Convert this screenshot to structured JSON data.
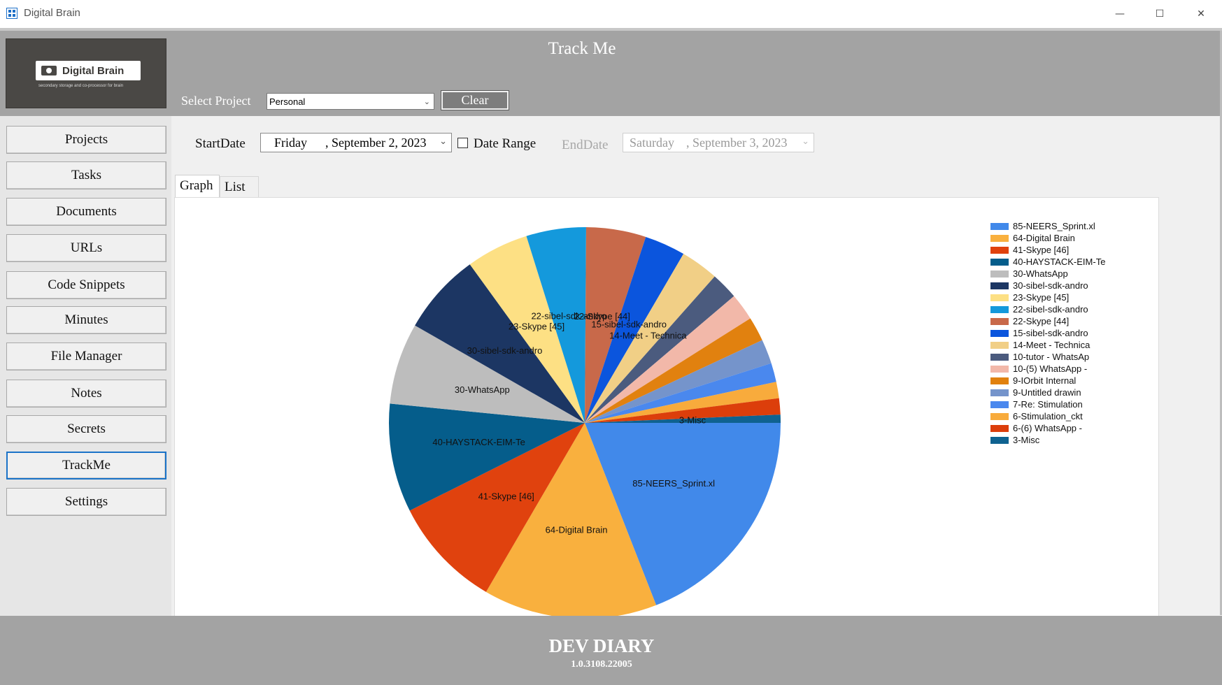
{
  "window": {
    "title": "Digital Brain",
    "minimize": "—",
    "maximize": "☐",
    "close": "✕"
  },
  "logo": {
    "name": "Digital Brain",
    "tagline": "secondary storage and co-processor for brain"
  },
  "header": {
    "title": "Track Me",
    "select_label": "Select Project",
    "project_value": "Personal",
    "clear_label": "Clear"
  },
  "sidebar": {
    "items": [
      {
        "label": "Projects"
      },
      {
        "label": "Tasks"
      },
      {
        "label": "Documents"
      },
      {
        "label": "URLs"
      },
      {
        "label": "Code Snippets"
      },
      {
        "label": "Minutes"
      },
      {
        "label": "File Manager"
      },
      {
        "label": "Notes"
      },
      {
        "label": "Secrets"
      },
      {
        "label": "TrackMe"
      },
      {
        "label": "Settings"
      }
    ],
    "active": "TrackMe"
  },
  "filters": {
    "start_label": "StartDate",
    "start": {
      "day": "Friday",
      "rest": ", September   2, 2023"
    },
    "range_label": "Date Range",
    "range_checked": false,
    "end_label": "EndDate",
    "end": {
      "day": "Saturday",
      "rest": ", September   3, 2023"
    }
  },
  "tabs": {
    "graph": "Graph",
    "list": "List",
    "active": "Graph"
  },
  "chart_data": {
    "type": "pie",
    "start_angle_deg": 0,
    "direction": "clockwise",
    "slices": [
      {
        "label": "85-NEERS_Sprint.xl",
        "value": 85,
        "color": "#4189ea",
        "show_label": true
      },
      {
        "label": "64-Digital Brain",
        "value": 64,
        "color": "#f9b03e",
        "show_label": true
      },
      {
        "label": "41-Skype [46]",
        "value": 41,
        "color": "#e0420e",
        "show_label": true
      },
      {
        "label": "40-HAYSTACK-EIM-Te",
        "value": 40,
        "color": "#055d8b",
        "show_label": true
      },
      {
        "label": "30-WhatsApp",
        "value": 30,
        "color": "#bdbdbd",
        "show_label": true
      },
      {
        "label": "30-sibel-sdk-andro",
        "value": 30,
        "color": "#1c3663",
        "show_label": true
      },
      {
        "label": "23-Skype [45]",
        "value": 23,
        "color": "#fde084",
        "show_label": true
      },
      {
        "label": "22-sibel-sdk-andro",
        "value": 22,
        "color": "#1499dc",
        "show_label": true
      },
      {
        "label": "22-Skype [44]",
        "value": 22,
        "color": "#c8694a",
        "show_label": true
      },
      {
        "label": "15-sibel-sdk-andro",
        "value": 15,
        "color": "#0b55dd",
        "show_label": true
      },
      {
        "label": "14-Meet - Technica",
        "value": 14,
        "color": "#f1cf86",
        "show_label": true
      },
      {
        "label": "10-tutor - WhatsAp",
        "value": 10,
        "color": "#4b5b7e",
        "show_label": false
      },
      {
        "label": "10-(5) WhatsApp -",
        "value": 10,
        "color": "#f2b8a9",
        "show_label": false
      },
      {
        "label": "9-IOrbit Internal",
        "value": 9,
        "color": "#e1810f",
        "show_label": false
      },
      {
        "label": "9-Untitled drawin",
        "value": 9,
        "color": "#7594cb",
        "show_label": false
      },
      {
        "label": "7-Re: Stimulation",
        "value": 7,
        "color": "#4a88ee",
        "show_label": false
      },
      {
        "label": "6-Stimulation_ckt",
        "value": 6,
        "color": "#f8ab3c",
        "show_label": false
      },
      {
        "label": "6-(6) WhatsApp -",
        "value": 6,
        "color": "#dc3e0b",
        "show_label": false
      },
      {
        "label": "3-Misc",
        "value": 3,
        "color": "#0f6290",
        "show_label": true
      }
    ]
  },
  "footer": {
    "title": "DEV DIARY",
    "version": "1.0.3108.22005"
  }
}
